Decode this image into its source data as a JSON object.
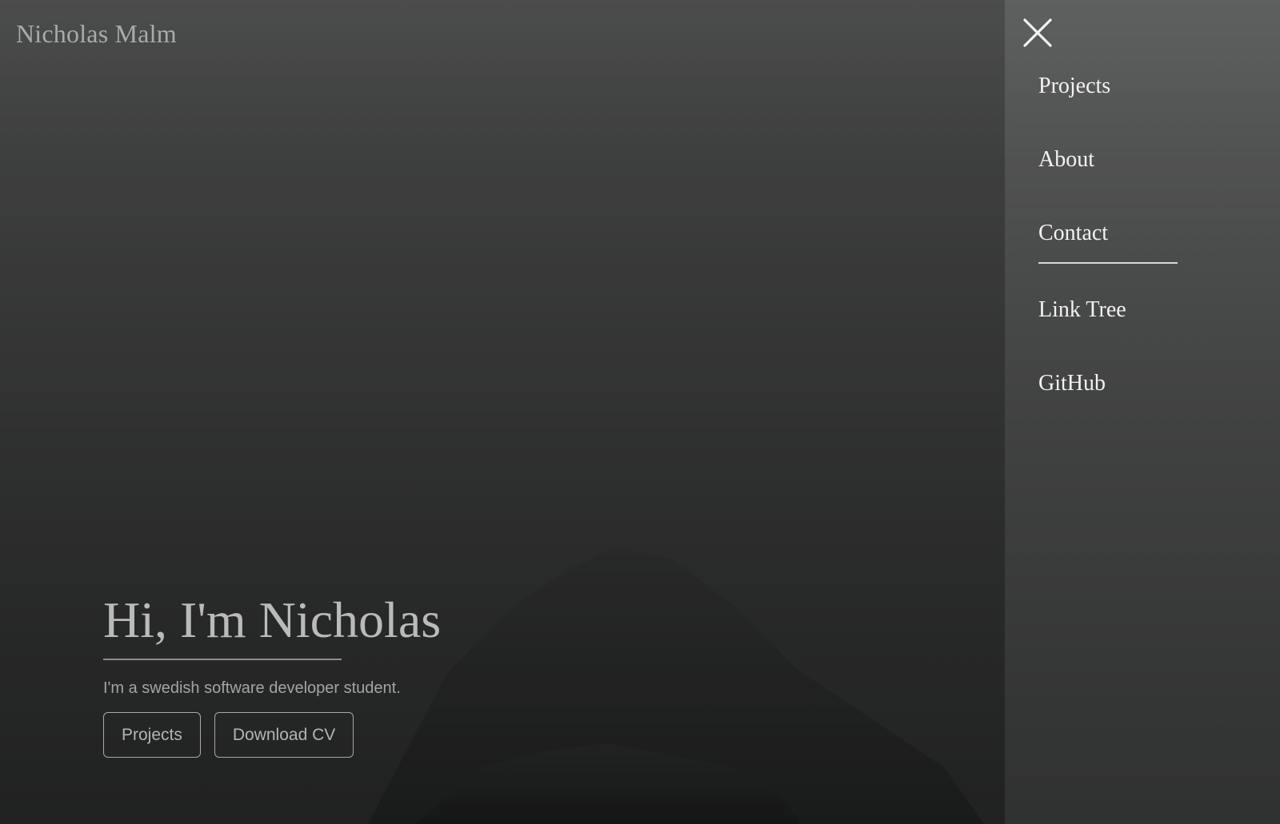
{
  "brand": {
    "name": "Nicholas Malm"
  },
  "hero": {
    "title": "Hi, I'm Nicholas",
    "subtitle": "I'm a swedish software developer student.",
    "buttons": [
      {
        "label": "Projects"
      },
      {
        "label": "Download CV"
      }
    ]
  },
  "menu": {
    "close_icon": "close-icon",
    "primary_items": [
      {
        "label": "Projects"
      },
      {
        "label": "About"
      },
      {
        "label": "Contact"
      }
    ],
    "secondary_items": [
      {
        "label": "Link Tree"
      },
      {
        "label": "GitHub"
      }
    ]
  },
  "colors": {
    "menu_text": "#f2f2f2",
    "hero_text": "#b9baba",
    "button_border": "#a8a9a9"
  }
}
